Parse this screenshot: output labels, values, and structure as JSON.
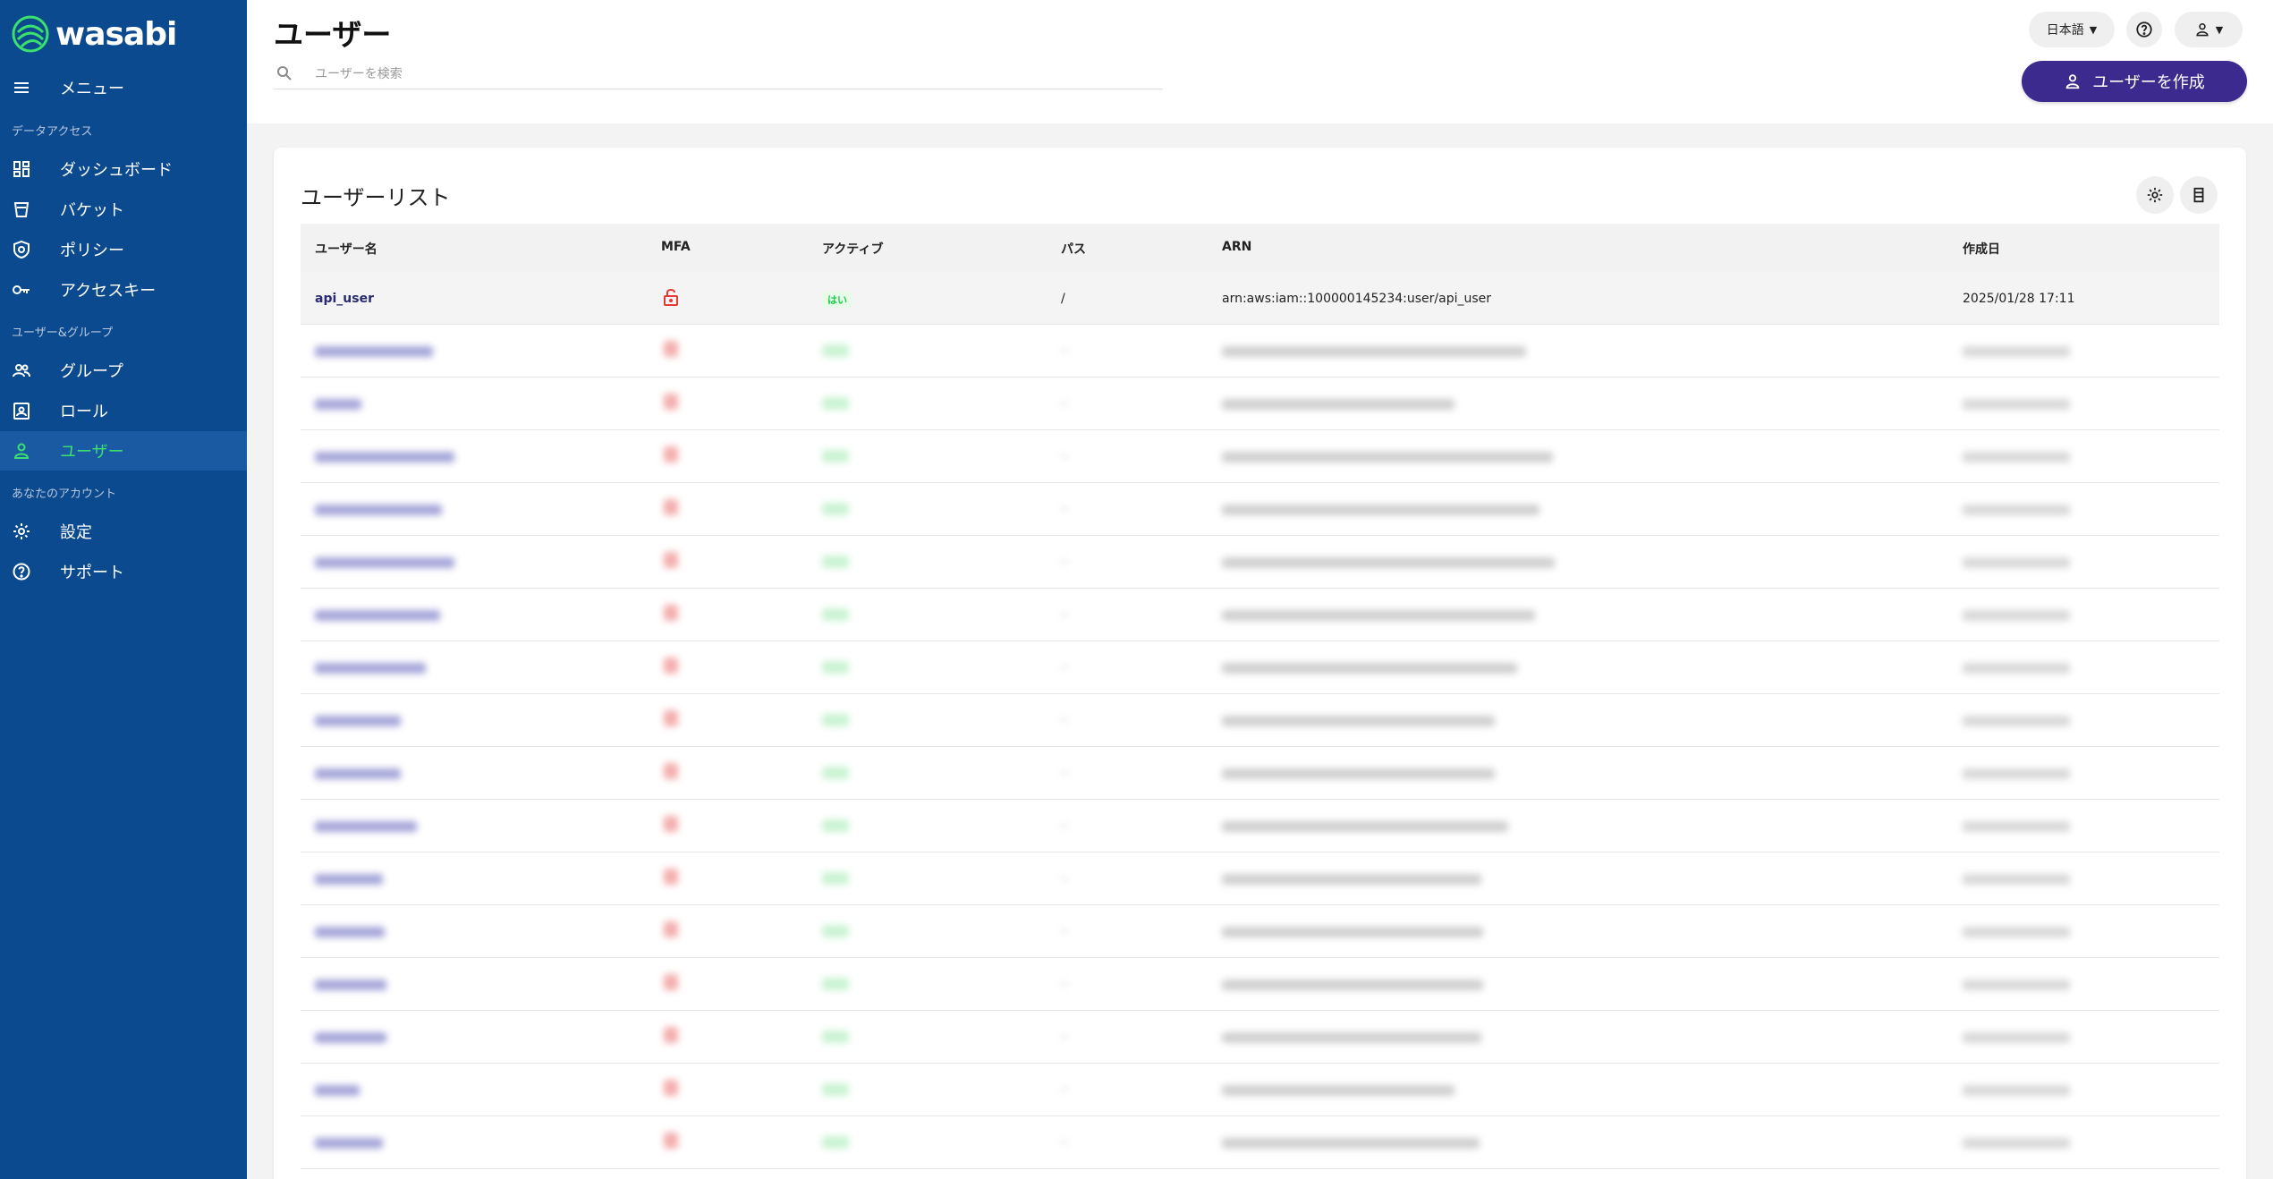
{
  "sidebar": {
    "logo_text": "wasabi",
    "menu_label": "メニュー",
    "sections": [
      {
        "label": "データアクセス"
      },
      {
        "label": "ユーザー&グループ"
      },
      {
        "label": "あなたのアカウント"
      }
    ],
    "items": [
      {
        "label": "ダッシュボード",
        "icon": "dashboard-icon"
      },
      {
        "label": "バケット",
        "icon": "bucket-icon"
      },
      {
        "label": "ポリシー",
        "icon": "policy-shield-icon"
      },
      {
        "label": "アクセスキー",
        "icon": "key-icon"
      },
      {
        "label": "グループ",
        "icon": "group-icon"
      },
      {
        "label": "ロール",
        "icon": "role-badge-icon"
      },
      {
        "label": "ユーザー",
        "icon": "user-icon",
        "active": true
      },
      {
        "label": "設定",
        "icon": "gear-icon"
      },
      {
        "label": "サポート",
        "icon": "help-circle-icon"
      }
    ]
  },
  "header": {
    "title": "ユーザー",
    "search_placeholder": "ユーザーを検索",
    "language": "日本語",
    "create_button": "ユーザーを作成"
  },
  "card": {
    "title": "ユーザーリスト",
    "columns": {
      "username": "ユーザー名",
      "mfa": "MFA",
      "active": "アクティブ",
      "path": "パス",
      "arn": "ARN",
      "created": "作成日"
    },
    "rows": [
      {
        "username": "api_user",
        "active": "はい",
        "path": "/",
        "arn": "arn:aws:iam::100000145234:user/api_user",
        "created": "2025/01/28 17:11"
      }
    ]
  },
  "colors": {
    "sidebar_bg": "#0c4a8f",
    "sidebar_active_bg": "#1a5aa3",
    "active_accent": "#3ce06e",
    "primary_button": "#3d2a8f",
    "mfa_disabled": "#e53935",
    "active_yes": "#1fcc4f"
  }
}
